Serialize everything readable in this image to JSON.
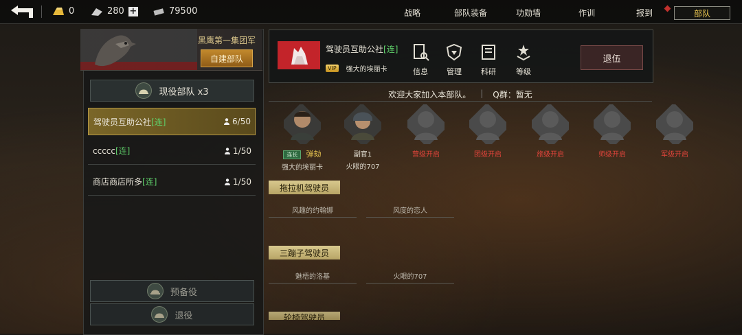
{
  "topbar": {
    "gold": "0",
    "fuel": "280",
    "steel": "79500",
    "nav": [
      "战略",
      "部队装备",
      "功勋墙",
      "作训",
      "报到",
      "部队"
    ]
  },
  "left": {
    "group_name": "黑鹰第一集团军",
    "self_build": "自建部队",
    "active_units": "现役部队 x3",
    "units": [
      {
        "name": "驾驶员互助公社",
        "tag": "[连]",
        "count": "6/50"
      },
      {
        "name": "ccccc",
        "tag": "[连]",
        "count": "1/50"
      },
      {
        "name": "商店商店所多",
        "tag": "[连]",
        "count": "1/50"
      }
    ],
    "reserve": "预备役",
    "retire": "退役"
  },
  "info": {
    "club_name": "驾驶员互助公社",
    "club_tag": "[连]",
    "vip": "VIP",
    "leader": "强大的埃丽卡",
    "menu": [
      "信息",
      "管理",
      "科研",
      "等级"
    ],
    "quit": "退伍",
    "welcome": "欢迎大家加入本部队。",
    "qq": "Q群：暂无"
  },
  "roster": [
    {
      "title": "弹劾",
      "rank": "连长",
      "name": "强大的埃丽卡",
      "locked": false
    },
    {
      "title": "副官1",
      "name": "火眼的707",
      "locked": false
    },
    {
      "title": "营级开启",
      "locked": true
    },
    {
      "title": "团级开启",
      "locked": true
    },
    {
      "title": "旅级开启",
      "locked": true
    },
    {
      "title": "师级开启",
      "locked": true
    },
    {
      "title": "军级开启",
      "locked": true
    }
  ],
  "groups": [
    {
      "title": "拖拉机驾驶员",
      "members": [
        "风趣的约翰娜",
        "风度的恋人"
      ]
    },
    {
      "title": "三蹦子驾驶员",
      "members": [
        "魅梧的洛基",
        "火眼的707"
      ]
    },
    {
      "title": "轮椅驾驶员",
      "members": []
    }
  ],
  "colors": {
    "accent_gold": "#e6c34f",
    "lock_red": "#e0443a",
    "link_green": "#5fd06a"
  }
}
